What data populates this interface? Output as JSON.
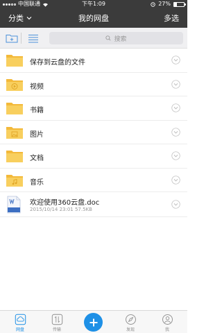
{
  "status": {
    "carrier": "中国联通",
    "time": "下午1:09",
    "battery": "27%",
    "battery_level": 0.27
  },
  "nav": {
    "left_label": "分类",
    "title": "我的网盘",
    "right_label": "多选"
  },
  "toolbar": {
    "search_placeholder": "搜索"
  },
  "folders": [
    {
      "name": "保存到云盘的文件",
      "icon": "folder-icon"
    },
    {
      "name": "视频",
      "icon": "video-folder-icon"
    },
    {
      "name": "书籍",
      "icon": "book-folder-icon"
    },
    {
      "name": "图片",
      "icon": "image-folder-icon"
    },
    {
      "name": "文档",
      "icon": "document-folder-icon"
    },
    {
      "name": "音乐",
      "icon": "music-folder-icon"
    }
  ],
  "file": {
    "name": "欢迎使用360云盘.doc",
    "meta": "2015/10/14 23:01 57.5KB",
    "icon": "word-doc-icon"
  },
  "tabs": [
    {
      "label": "网盘",
      "icon": "cloud-disk-icon",
      "active": true
    },
    {
      "label": "传输",
      "icon": "transfer-icon",
      "active": false
    },
    {
      "label": "",
      "icon": "plus-icon",
      "active": false
    },
    {
      "label": "发现",
      "icon": "compass-icon",
      "active": false
    },
    {
      "label": "我",
      "icon": "user-icon",
      "active": false
    }
  ],
  "colors": {
    "header_bg": "#3b3b3b",
    "folder": "#f6c343",
    "accent": "#1e90e6"
  }
}
